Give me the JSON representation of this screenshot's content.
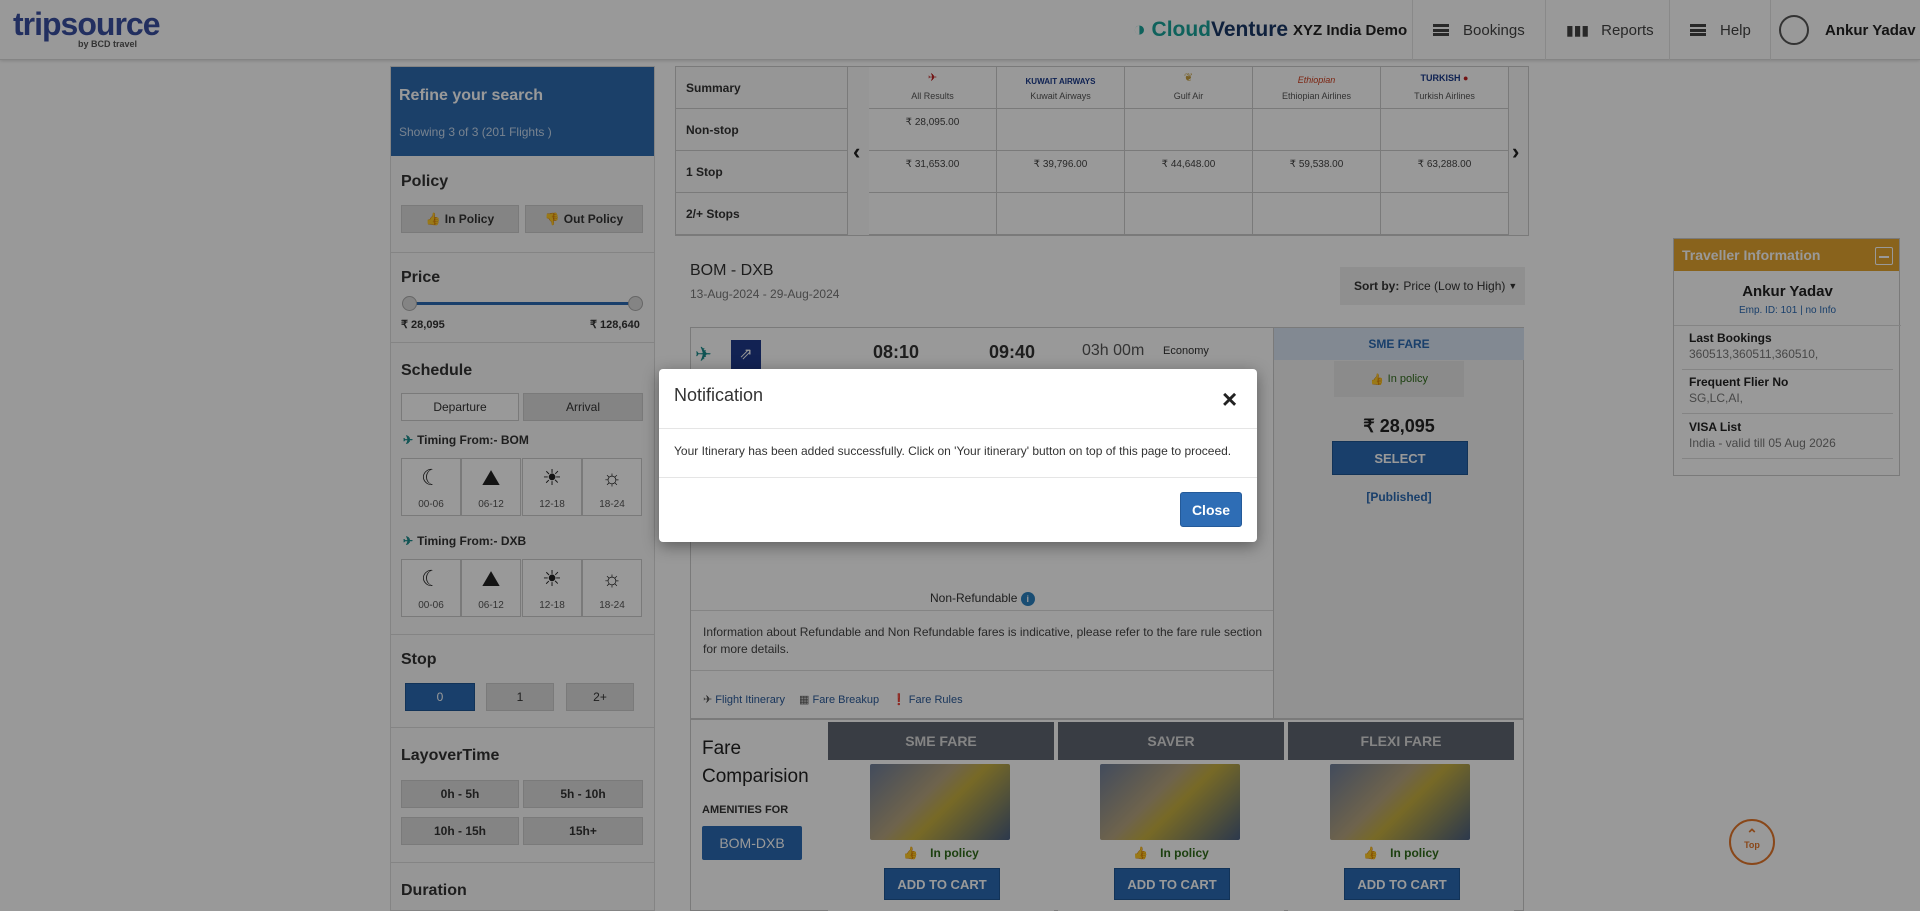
{
  "header": {
    "logo": "tripsource",
    "logo_sub": "by BCD travel",
    "brand_cloud": "Cloud",
    "brand_venture": "Venture",
    "org": "XYZ India Demo",
    "bookings": "Bookings",
    "reports": "Reports",
    "help": "Help",
    "user": "Ankur Yadav"
  },
  "sidebar": {
    "refine_title": "Refine your search",
    "refine_sub": "Showing 3 of 3 (201 Flights )",
    "policy_title": "Policy",
    "in_policy": "In Policy",
    "out_policy": "Out Policy",
    "price_title": "Price",
    "price_min": "₹ 28,095",
    "price_max": "₹ 128,640",
    "schedule_title": "Schedule",
    "departure": "Departure",
    "arrival": "Arrival",
    "timing_from_1": "Timing From:- BOM",
    "timing_from_2": "Timing From:- DXB",
    "slots": [
      "00-06",
      "06-12",
      "12-18",
      "18-24"
    ],
    "stop_title": "Stop",
    "stops": [
      "0",
      "1",
      "2+"
    ],
    "layover_title": "LayoverTime",
    "layovers": [
      "0h - 5h",
      "5h - 10h",
      "10h - 15h",
      "15h+"
    ],
    "duration_title": "Duration"
  },
  "summary": {
    "rows": [
      "Summary",
      "Non-stop",
      "1 Stop",
      "2/+ Stops"
    ],
    "airlines": [
      "All Results",
      "Kuwait Airways",
      "Gulf Air",
      "Ethiopian Airlines",
      "Turkish Airlines"
    ],
    "nonstop": [
      "₹ 28,095.00",
      "",
      "",
      "",
      ""
    ],
    "onestop": [
      "₹ 31,653.00",
      "₹ 39,796.00",
      "₹ 44,648.00",
      "₹ 59,538.00",
      "₹ 63,288.00"
    ]
  },
  "results": {
    "route": "BOM - DXB",
    "dates": "13-Aug-2024  - 29-Aug-2024",
    "sort_label": "Sort by:",
    "sort_value": "Price (Low to High)",
    "dep_time": "08:10",
    "arr_time": "09:40",
    "duration": "03h 00m",
    "cabin": "Economy",
    "fare_type": "SME FARE",
    "in_policy": "In policy",
    "price": "₹ 28,095",
    "select": "SELECT",
    "published": "[Published]",
    "non_refundable": "Non-Refundable",
    "refund_info": "Information about Refundable and Non Refundable fares is indicative, please refer to the fare rule section for more details.",
    "links": [
      "Flight Itinerary",
      "Fare Breakup",
      "Fare Rules"
    ]
  },
  "compare": {
    "title_1": "Fare",
    "title_2": "Comparision",
    "amenities": "AMENITIES FOR",
    "route_btn": "BOM-DXB",
    "fares": [
      "SME FARE",
      "SAVER",
      "FLEXI FARE"
    ],
    "in_policy": "In policy",
    "add_to_cart": "ADD TO CART"
  },
  "traveller": {
    "header": "Traveller Information",
    "name": "Ankur Yadav",
    "emp": "Emp. ID: 101 | no Info",
    "last_bookings_label": "Last Bookings",
    "last_bookings": "360513,360511,360510,",
    "ff_label": "Frequent Flier No",
    "ff": "SG,LC,AI,",
    "visa_label": "VISA List",
    "visa": "India - valid till 05 Aug 2026"
  },
  "top_label": "Top",
  "modal": {
    "title": "Notification",
    "body": "Your Itinerary has been added successfully. Click on 'Your itinerary' button on top of this page to proceed.",
    "close": "Close"
  }
}
